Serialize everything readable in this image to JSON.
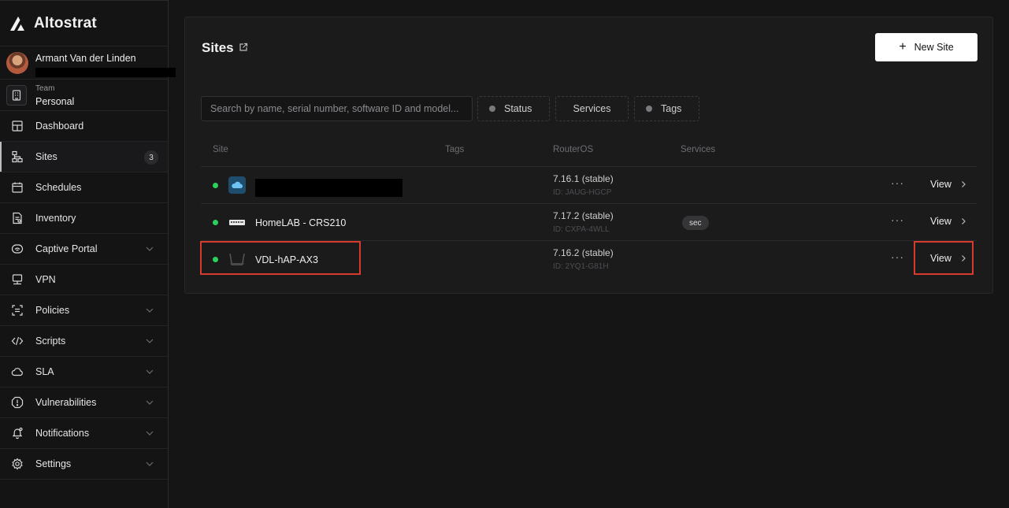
{
  "brand": {
    "name": "Altostrat"
  },
  "user": {
    "name": "Armant Van der Linden"
  },
  "team": {
    "label": "Team",
    "value": "Personal"
  },
  "nav": [
    {
      "id": "dashboard",
      "label": "Dashboard",
      "icon": "dashboard-icon"
    },
    {
      "id": "sites",
      "label": "Sites",
      "icon": "sites-icon",
      "badge": "3",
      "active": true
    },
    {
      "id": "schedules",
      "label": "Schedules",
      "icon": "calendar-icon"
    },
    {
      "id": "inventory",
      "label": "Inventory",
      "icon": "inventory-icon"
    },
    {
      "id": "captive-portal",
      "label": "Captive Portal",
      "icon": "wifi-icon",
      "expandable": true
    },
    {
      "id": "vpn",
      "label": "VPN",
      "icon": "vpn-icon"
    },
    {
      "id": "policies",
      "label": "Policies",
      "icon": "policies-icon",
      "expandable": true
    },
    {
      "id": "scripts",
      "label": "Scripts",
      "icon": "code-icon",
      "expandable": true
    },
    {
      "id": "sla",
      "label": "SLA",
      "icon": "cloud-icon",
      "expandable": true
    },
    {
      "id": "vulnerabilities",
      "label": "Vulnerabilities",
      "icon": "alert-icon",
      "expandable": true
    },
    {
      "id": "notifications",
      "label": "Notifications",
      "icon": "bell-icon",
      "expandable": true
    },
    {
      "id": "settings",
      "label": "Settings",
      "icon": "gear-icon",
      "expandable": true
    }
  ],
  "page": {
    "title": "Sites",
    "new_site_label": "New Site",
    "search_placeholder": "Search by name, serial number, software ID and model...",
    "filters": [
      {
        "label": "Status",
        "dot": true
      },
      {
        "label": "Services",
        "dot": false
      },
      {
        "label": "Tags",
        "dot": true
      }
    ],
    "columns": {
      "site": "Site",
      "tags": "Tags",
      "routeros": "RouterOS",
      "services": "Services"
    }
  },
  "rows": [
    {
      "name": "",
      "redacted": true,
      "device": "cloud-device-icon",
      "version": "7.16.1 (stable)",
      "id": "ID: JAUG-HGCP",
      "services": "",
      "view": "View",
      "more": "···"
    },
    {
      "name": "HomeLAB - CRS210",
      "redacted": false,
      "device": "switch-device-icon",
      "version": "7.17.2 (stable)",
      "id": "ID: CXPA-4WLL",
      "services": "sec",
      "view": "View",
      "more": "···"
    },
    {
      "name": "VDL-hAP-AX3",
      "redacted": false,
      "device": "router-device-icon",
      "version": "7.16.2 (stable)",
      "id": "ID: 2YQ1-G81H",
      "services": "",
      "view": "View",
      "more": "···"
    }
  ],
  "colors": {
    "accent_highlight": "#d63b2e",
    "status_online": "#2ad15a"
  }
}
